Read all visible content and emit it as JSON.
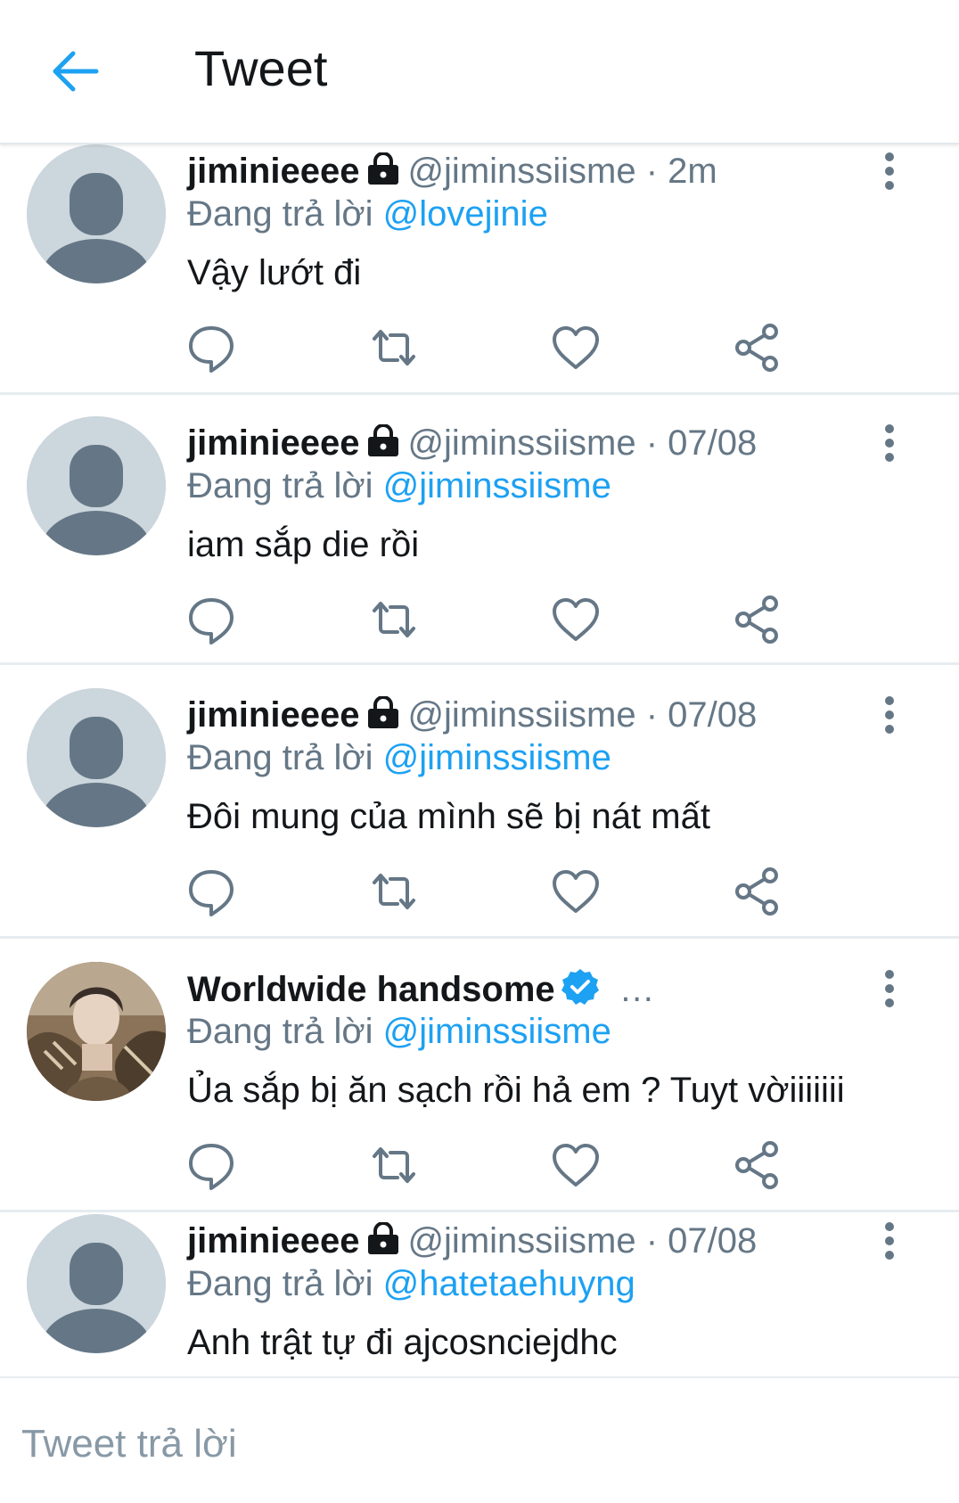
{
  "header": {
    "title": "Tweet",
    "back_icon": "arrow-left-icon",
    "accent_color": "#1da1f2"
  },
  "tweets": [
    {
      "name": "jiminieeee",
      "handle": "@jiminssiisme",
      "time": " · 2m",
      "protected": true,
      "replying_prefix": "Đang trả lời",
      "replying_to": "@lovejinie",
      "text": "Vậy lướt đi"
    },
    {
      "name": "jiminieeee",
      "handle": "@jiminssiisme",
      "time": " · 07/08",
      "protected": true,
      "replying_prefix": "Đang trả lời",
      "replying_to": "@jiminssiisme",
      "text": "iam sắp die rồi"
    },
    {
      "name": "jiminieeee",
      "handle": "@jiminssiisme",
      "time": " · 07/08",
      "protected": true,
      "replying_prefix": "Đang trả lời",
      "replying_to": "@jiminssiisme",
      "text": "Đôi mung của mình sẽ bị nát mất"
    },
    {
      "name": "Worldwide handsome",
      "verified": true,
      "truncated": "…",
      "replying_prefix": "Đang trả lời",
      "replying_to": "@jiminssiisme",
      "text": "Ủa sắp bị ăn sạch rồi hả em ? Tuyt vờiiiiiii"
    },
    {
      "name": "jiminieeee",
      "handle": "@jiminssiisme",
      "time": " · 07/08",
      "protected": true,
      "replying_prefix": "Đang trả lời",
      "replying_to": "@hatetaehuyng",
      "text": "Anh trật tự đi ajcosnciejdhc"
    }
  ],
  "action_icons": [
    "reply-icon",
    "retweet-icon",
    "like-icon",
    "share-icon"
  ],
  "compose": {
    "placeholder": "Tweet trả lời"
  }
}
